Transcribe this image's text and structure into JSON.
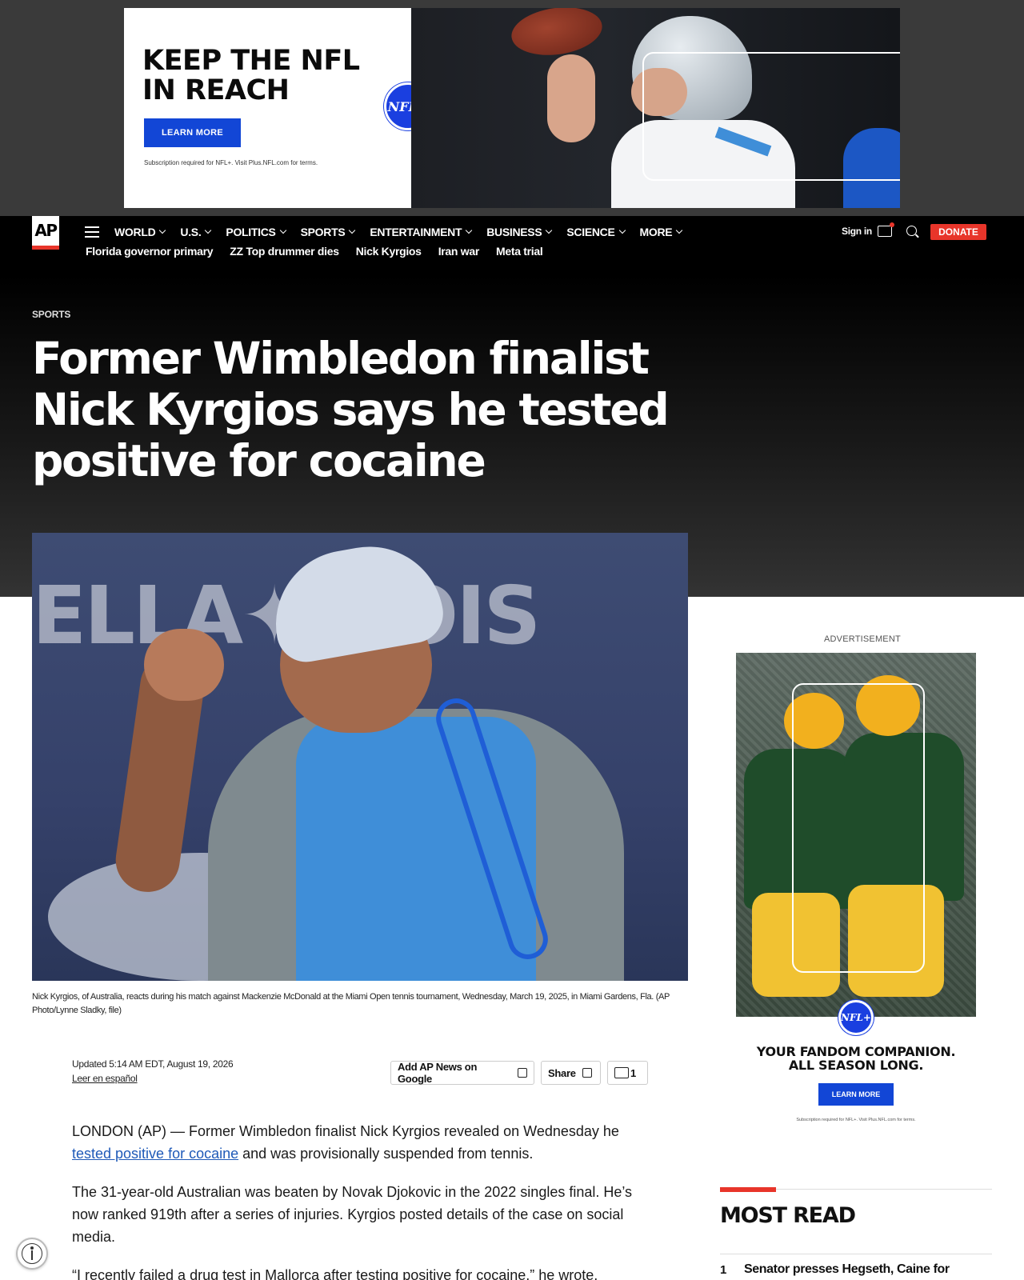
{
  "top_ad": {
    "headline": "KEEP THE NFL IN REACH",
    "button": "LEARN MORE",
    "fine_print": "Subscription required for NFL+. Visit Plus.NFL.com for terms.",
    "badge": "NFL+"
  },
  "nav": {
    "logo": "AP",
    "items": [
      {
        "label": "WORLD"
      },
      {
        "label": "U.S."
      },
      {
        "label": "POLITICS"
      },
      {
        "label": "SPORTS"
      },
      {
        "label": "ENTERTAINMENT"
      },
      {
        "label": "BUSINESS"
      },
      {
        "label": "SCIENCE"
      },
      {
        "label": "MORE"
      }
    ],
    "trending": [
      "Florida governor primary",
      "ZZ Top drummer dies",
      "Nick Kyrgios",
      "Iran war",
      "Meta trial"
    ],
    "signin": "Sign in",
    "donate": "DONATE",
    "icons": [
      "menu-icon",
      "chat-icon",
      "search-icon"
    ]
  },
  "article": {
    "section": "SPORTS",
    "headline": "Former Wimbledon finalist Nick Kyrgios says he tested positive for cocaine",
    "photo_banner_text": "ELLA✦A OIS",
    "caption": "Nick Kyrgios, of Australia, reacts during his match against Mackenzie McDonald at the Miami Open tennis tournament, Wednesday, March 19, 2025, in Miami Gardens, Fla. (AP Photo/Lynne Sladky, file)",
    "updated": "Updated 5:14 AM EDT, August 19, 2026",
    "spanish_link": "Leer en español",
    "actions": {
      "google": "Add AP News on Google",
      "share": "Share",
      "comments": "1"
    },
    "p1_before": "LONDON (AP) — Former Wimbledon finalist Nick Kyrgios revealed on Wednesday he ",
    "p1_link": "tested positive for cocaine",
    "p1_after": " and was provisionally suspended from tennis.",
    "p2": "The 31-year-old Australian was beaten by Novak Djokovic in the 2022 singles final. He’s now ranked 919th after a series of injuries. Kyrgios posted details of the case on social media.",
    "p3": "“I recently failed a drug test in Mallorca after testing positive for cocaine,” he wrote,"
  },
  "side_ad": {
    "label": "ADVERTISEMENT",
    "badge": "NFL+",
    "title_line1": "YOUR FANDOM COMPANION.",
    "title_line2": "ALL SEASON LONG.",
    "button": "LEARN MORE",
    "fine_print": "Subscription required for NFL+. Visit Plus.NFL.com for terms."
  },
  "most_read": {
    "title": "MOST READ",
    "items": [
      {
        "num": "1",
        "text": "Senator presses Hegseth, Caine for"
      }
    ]
  },
  "colors": {
    "ap_red": "#e8352a",
    "nfl_blue": "#1246d6",
    "link_blue": "#1f5ab8"
  }
}
